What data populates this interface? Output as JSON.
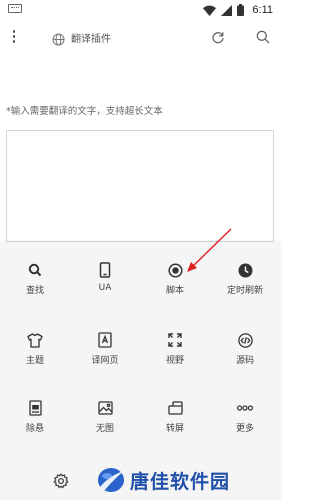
{
  "status_bar": {
    "time": "6:11",
    "icons": [
      "keyboard-icon",
      "wifi-icon",
      "signal-icon",
      "battery-icon"
    ]
  },
  "toolbar": {
    "url_text": "翻译插件",
    "icons": [
      "more-vert-icon",
      "globe-icon",
      "refresh-icon",
      "search-icon"
    ]
  },
  "translator": {
    "hint": "*输入需要翻译的文字，支持超长文本",
    "input_value": ""
  },
  "menu": {
    "rows": [
      [
        {
          "label": "查找",
          "icon": "search-icon"
        },
        {
          "label": "UA",
          "icon": "phone-icon"
        },
        {
          "label": "脚本",
          "icon": "record-icon"
        },
        {
          "label": "定时刷新",
          "icon": "clock-icon"
        }
      ],
      [
        {
          "label": "主题",
          "icon": "shirt-icon"
        },
        {
          "label": "译网页",
          "icon": "translate-page-icon"
        },
        {
          "label": "视野",
          "icon": "fullscreen-icon"
        },
        {
          "label": "源码",
          "icon": "code-icon"
        }
      ],
      [
        {
          "label": "除悬",
          "icon": "no-float-icon"
        },
        {
          "label": "无图",
          "icon": "no-image-icon"
        },
        {
          "label": "转屏",
          "icon": "rotate-screen-icon"
        },
        {
          "label": "更多",
          "icon": "more-horiz-icon"
        }
      ]
    ]
  },
  "bottom_bar": {
    "icons": [
      "settings-icon"
    ],
    "watermark": "唐佳软件园"
  },
  "colors": {
    "annotation_arrow": "#e02020",
    "menu_background": "#f5f5f5",
    "watermark_text": "#1f4fa8"
  }
}
